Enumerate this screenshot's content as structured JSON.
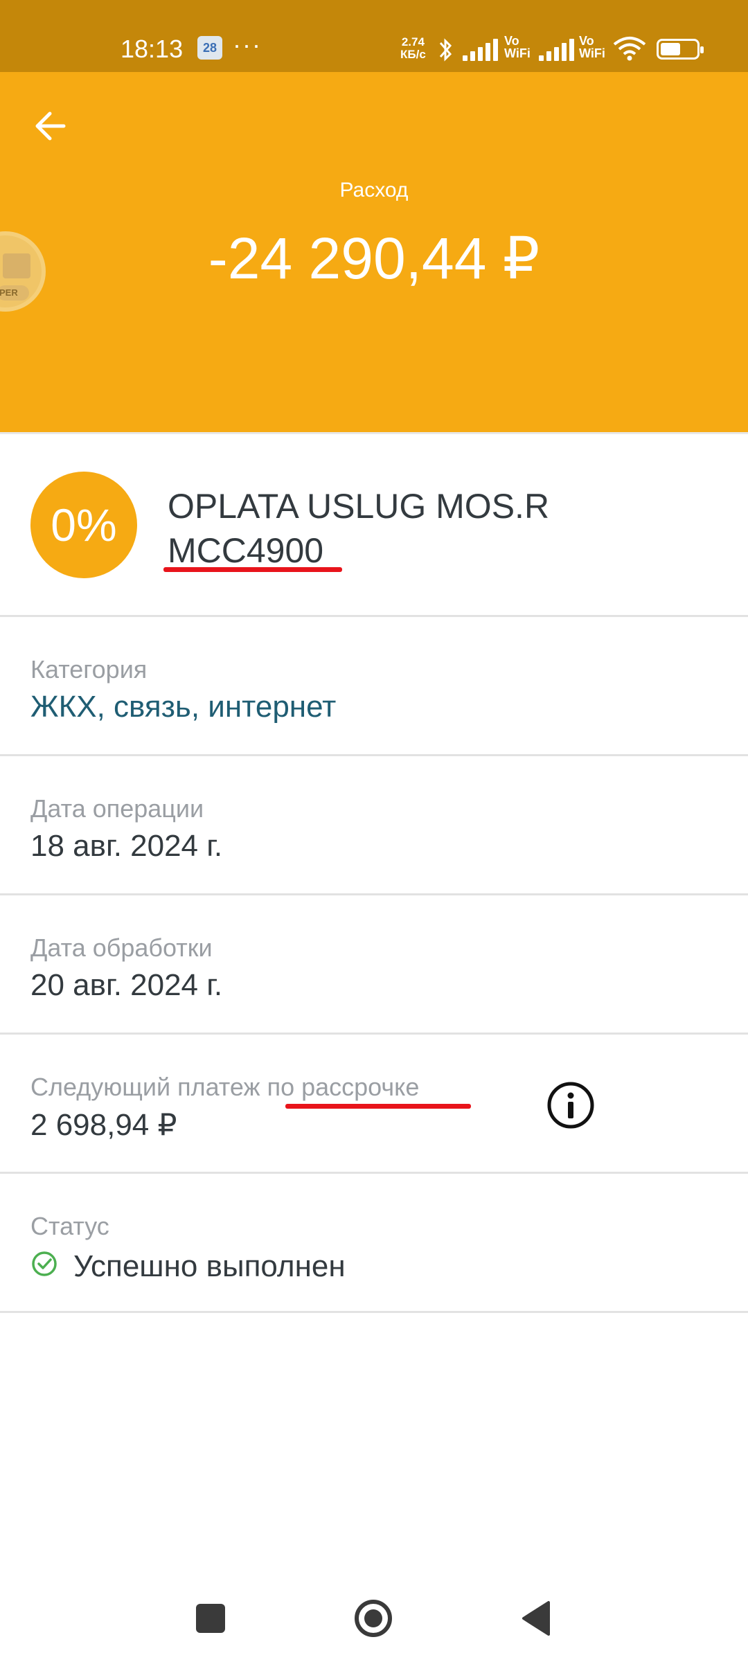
{
  "status_bar": {
    "time": "18:13",
    "calendar_day": "28",
    "dots": "···",
    "net_speed_value": "2.74",
    "net_speed_unit": "КБ/с",
    "vowifi_top": "Vo",
    "vowifi_bottom": "WiFi",
    "battery_level": 0.55
  },
  "header": {
    "label": "Расход",
    "amount": "-24 290,44 ₽",
    "partner_badge_text": "PER",
    "background_color": "#f6aa13"
  },
  "merchant": {
    "logo_text": "0%",
    "name_line1": "OPLATA USLUG MOS.R",
    "name_line2": "MCC4900"
  },
  "details": {
    "category": {
      "label": "Категория",
      "value": "ЖКХ, связь, интернет"
    },
    "operation_date": {
      "label": "Дата операции",
      "value": "18 авг. 2024 г."
    },
    "processing_date": {
      "label": "Дата обработки",
      "value": "20 авг. 2024 г."
    },
    "installment": {
      "label": "Следующий платеж по рассрочке",
      "value": "2 698,94 ₽"
    },
    "status": {
      "label": "Статус",
      "value": "Успешно выполнен"
    }
  },
  "colors": {
    "accent": "#f6aa13",
    "status_bar": "#c4870a",
    "link": "#1f5d73",
    "annotation_red": "#e8141b",
    "success": "#4caf50"
  }
}
